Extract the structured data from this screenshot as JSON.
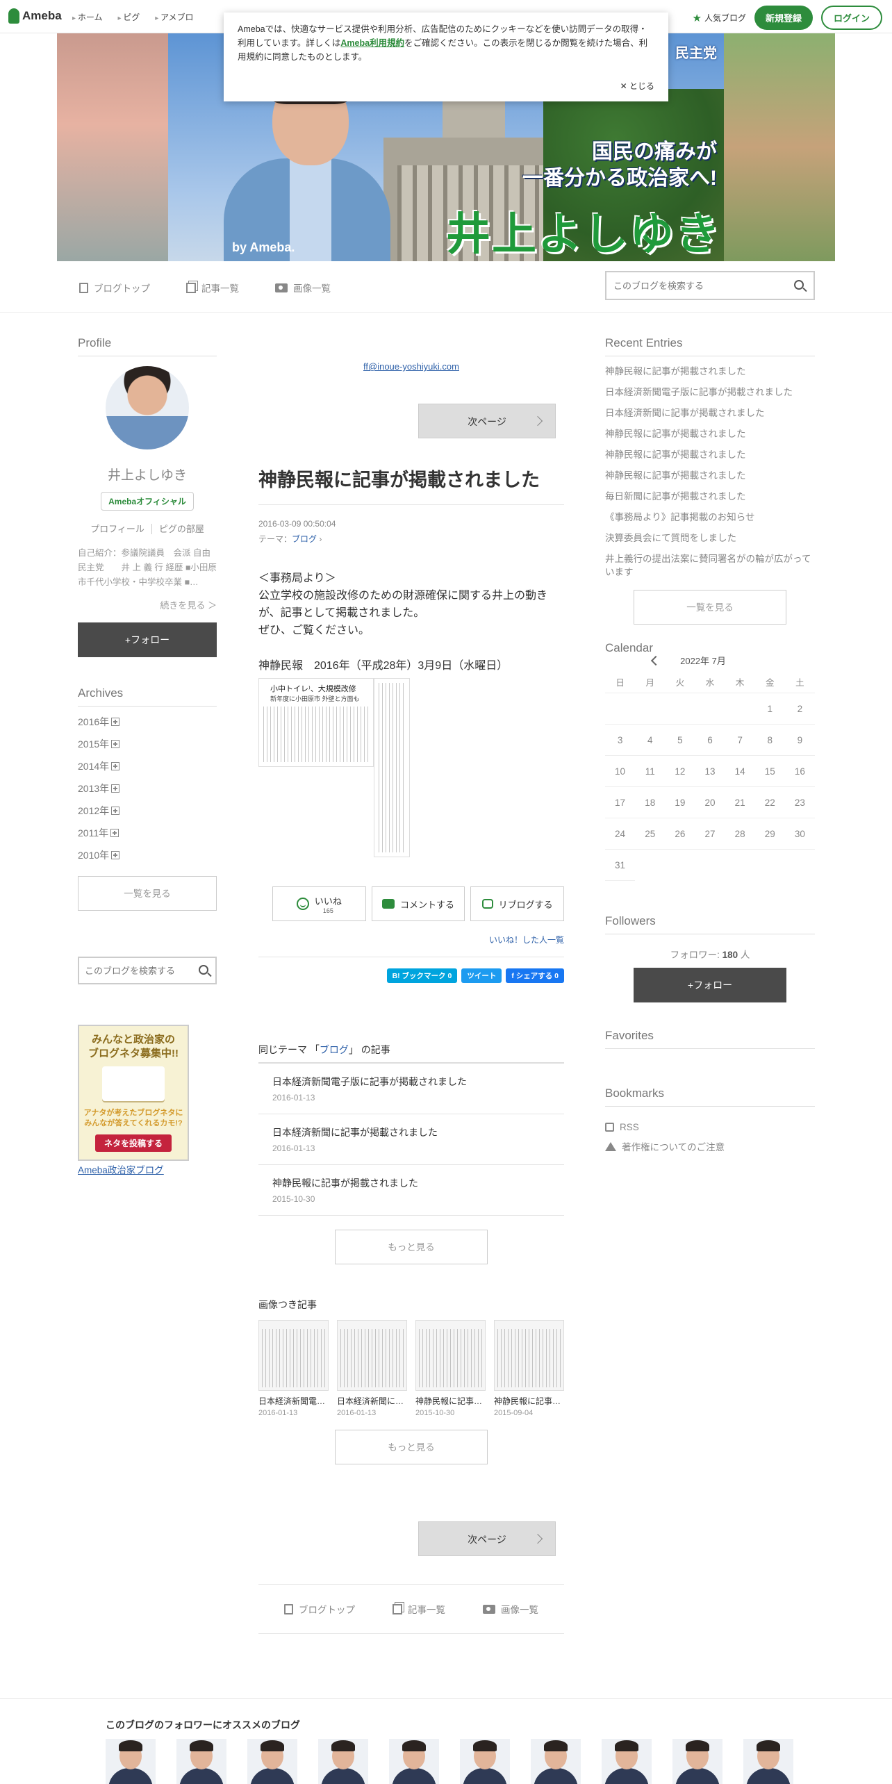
{
  "header": {
    "brand": "Ameba",
    "nav": [
      "ホーム",
      "ピグ",
      "アメブロ"
    ],
    "popular": "人気ブログ",
    "signup": "新規登録",
    "login": "ログイン"
  },
  "cookie": {
    "text_before": "Amebaでは、快適なサービス提供や利用分析、広告配信のためにクッキーなどを使い訪問データの取得・利用しています。詳しくは",
    "link": "Ameba利用規約",
    "text_after": "をご確認ください。この表示を閉じるか閲覧を続けた場合、利用規約に同意したものとします。",
    "close": "とじる"
  },
  "banner": {
    "party": "民主党",
    "slogan_1": "国民の痛みが",
    "slogan_2": "一番分かる政治家へ!",
    "name": "井上よしゆき",
    "by": "by Ameba."
  },
  "blognav": {
    "top": "ブログトップ",
    "list": "記事一覧",
    "images": "画像一覧",
    "search_placeholder": "このブログを検索する"
  },
  "profile": {
    "heading": "Profile",
    "name": "井上よしゆき",
    "badge": "Amebaオフィシャル",
    "link_profile": "プロフィール",
    "link_room": "ピグの部屋",
    "description": "自己紹介：参議院議員　会派 自由民主党　　井 上 義 行 経歴 ■小田原市千代小学校・中学校卒業 ■…",
    "more": "続きを見る ＞",
    "follow": "+フォロー"
  },
  "archives": {
    "heading": "Archives",
    "years": [
      "2016年",
      "2015年",
      "2014年",
      "2013年",
      "2012年",
      "2011年",
      "2010年"
    ],
    "see_all": "一覧を見る",
    "search_placeholder": "このブログを検索する"
  },
  "promo": {
    "title": "みんなと政治家の\nブログネタ募集中!!",
    "sub": "アナタが考えたブログネタに\nみんなが答えてくれるカモ!?",
    "cta": "ネタを投稿する",
    "link": "Ameba政治家ブログ"
  },
  "entry": {
    "email": "ff@inoue-yoshiyuki.com",
    "next": "次ページ",
    "title": "神静民報に記事が掲載されました",
    "date": "2016-03-09 00:50:04",
    "theme_label": "テーマ：",
    "theme": "ブログ",
    "body": "＜事務局より＞\n公立学校の施設改修のための財源確保に関する井上の動きが、記事として掲載されました。\nぜひ、ご覧ください。",
    "news_title": "神静民報　2016年（平成28年）3月9日（水曜日）",
    "clip_headline": "小中トイレ⁾、大規模改修",
    "clip_sub": "新年度に小田原市 外壁と方面も"
  },
  "reactions": {
    "like": "いいね",
    "like_count": "165",
    "comment": "コメントする",
    "reblog": "リブログする",
    "likers": "いいね！した人一覧"
  },
  "share": {
    "hatena": "B! ブックマーク  0",
    "tweet": "ツイート",
    "facebook": "f シェアする 0"
  },
  "same_theme": {
    "prefix": "同じテーマ 「",
    "theme": "ブログ",
    "suffix": "」 の記事",
    "items": [
      {
        "title": "日本経済新聞電子版に記事が掲載されました",
        "date": "2016-01-13"
      },
      {
        "title": "日本経済新聞に記事が掲載されました",
        "date": "2016-01-13"
      },
      {
        "title": "神静民報に記事が掲載されました",
        "date": "2015-10-30"
      }
    ],
    "more": "もっと見る"
  },
  "image_entries": {
    "heading": "画像つき記事",
    "items": [
      {
        "title": "日本経済新聞電…",
        "date": "2016-01-13"
      },
      {
        "title": "日本経済新聞に…",
        "date": "2016-01-13"
      },
      {
        "title": "神静民報に記事…",
        "date": "2015-10-30"
      },
      {
        "title": "神静民報に記事…",
        "date": "2015-09-04"
      }
    ],
    "more": "もっと見る"
  },
  "recent": {
    "heading": "Recent Entries",
    "items": [
      "神静民報に記事が掲載されました",
      "日本経済新聞電子版に記事が掲載されました",
      "日本経済新聞に記事が掲載されました",
      "神静民報に記事が掲載されました",
      "神静民報に記事が掲載されました",
      "神静民報に記事が掲載されました",
      "毎日新聞に記事が掲載されました",
      "《事務局より》記事掲載のお知らせ",
      "決算委員会にて質問をしました",
      "井上義行の提出法案に賛同署名がの輪が広がっています"
    ],
    "see_all": "一覧を見る"
  },
  "calendar": {
    "heading": "Calendar",
    "month": "2022年 7月",
    "dow": [
      "日",
      "月",
      "火",
      "水",
      "木",
      "金",
      "土"
    ],
    "days": [
      "",
      "",
      "",
      "",
      "",
      "1",
      "2",
      "3",
      "4",
      "5",
      "6",
      "7",
      "8",
      "9",
      "10",
      "11",
      "12",
      "13",
      "14",
      "15",
      "16",
      "17",
      "18",
      "19",
      "20",
      "21",
      "22",
      "23",
      "24",
      "25",
      "26",
      "27",
      "28",
      "29",
      "30",
      "31"
    ]
  },
  "followers": {
    "heading": "Followers",
    "label": "フォロワー:",
    "count": "180",
    "unit": "人",
    "follow": "+フォロー"
  },
  "favorites": {
    "heading": "Favorites"
  },
  "bookmarks": {
    "heading": "Bookmarks",
    "rss": "RSS",
    "copyright": "著作権についてのご注意"
  },
  "recommend": {
    "title": "このブログのフォロワーにオススメのブログ"
  },
  "colors": {
    "accent": "#2d8c3c",
    "link": "#2c5fa8",
    "dark_button": "#4a4a4a"
  }
}
